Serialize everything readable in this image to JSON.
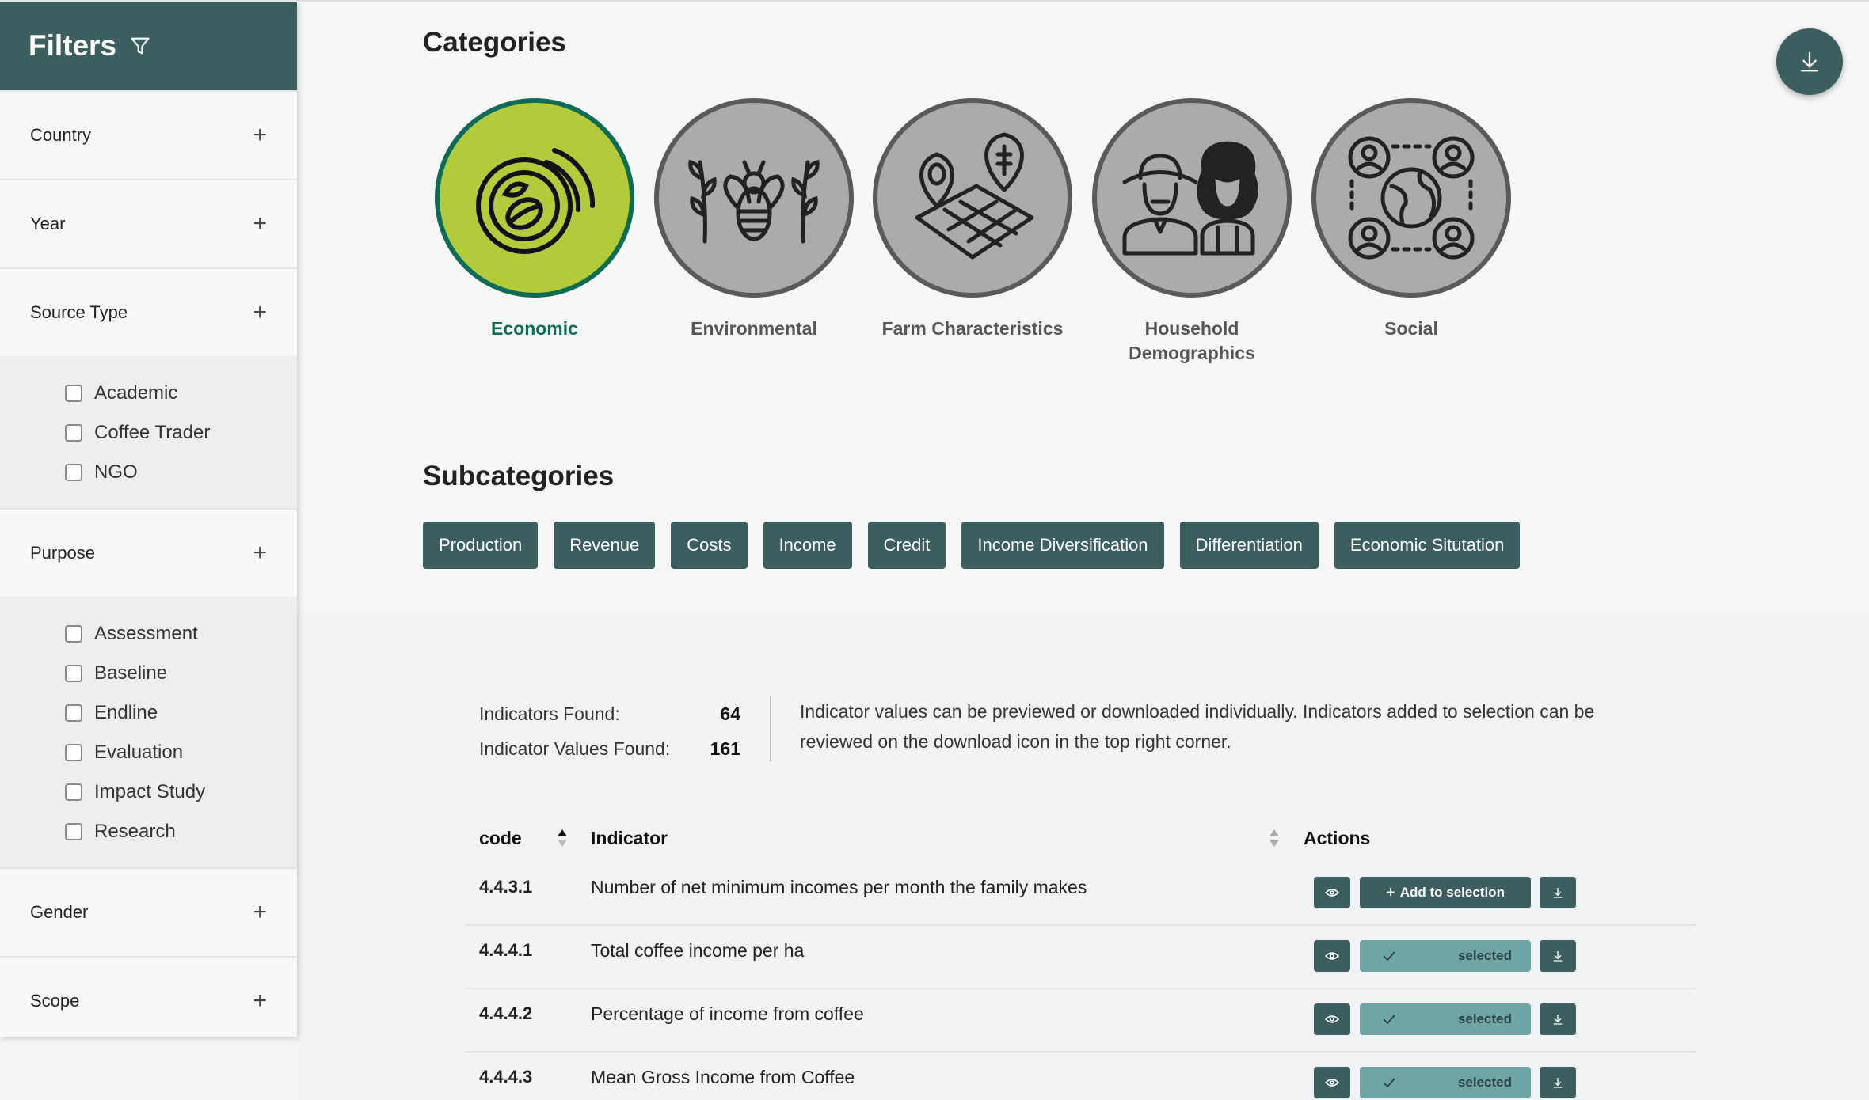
{
  "sidebar": {
    "title": "Filters",
    "sections": [
      {
        "label": "Country",
        "options": []
      },
      {
        "label": "Year",
        "options": []
      },
      {
        "label": "Source Type",
        "options": [
          "Academic",
          "Coffee Trader",
          "NGO"
        ]
      },
      {
        "label": "Purpose",
        "options": [
          "Assessment",
          "Baseline",
          "Endline",
          "Evaluation",
          "Impact Study",
          "Research"
        ]
      },
      {
        "label": "Gender",
        "options": []
      },
      {
        "label": "Scope",
        "options": []
      }
    ]
  },
  "categories": {
    "title": "Categories",
    "items": [
      {
        "label": "Economic",
        "icon": "coffee-beans-icon",
        "active": true
      },
      {
        "label": "Environmental",
        "icon": "bee-plants-icon",
        "active": false
      },
      {
        "label": "Farm Characteristics",
        "icon": "farm-map-icon",
        "active": false
      },
      {
        "label": "Household Demographics",
        "icon": "farmers-icon",
        "active": false
      },
      {
        "label": "Social",
        "icon": "community-globe-icon",
        "active": false
      }
    ]
  },
  "subcategories": {
    "title": "Subcategories",
    "items": [
      "Production",
      "Revenue",
      "Costs",
      "Income",
      "Credit",
      "Income Diversification",
      "Differentiation",
      "Economic Situtation"
    ]
  },
  "stats": {
    "indicators_label": "Indicators Found:",
    "indicators_value": "64",
    "values_label": "Indicator Values Found:",
    "values_value": "161",
    "info": "Indicator values can be previewed or downloaded individually. Indicators added to selection can be reviewed on the download icon in the top right corner."
  },
  "table": {
    "headers": {
      "code": "code",
      "indicator": "Indicator",
      "actions": "Actions"
    },
    "rows": [
      {
        "code": "4.4.3.1",
        "indicator": "Number of net minimum incomes per month the family makes",
        "selected": false
      },
      {
        "code": "4.4.4.1",
        "indicator": "Total coffee income per ha",
        "selected": true
      },
      {
        "code": "4.4.4.2",
        "indicator": "Percentage of income from coffee",
        "selected": true
      },
      {
        "code": "4.4.4.3",
        "indicator": "Mean Gross Income from Coffee",
        "selected": true
      }
    ],
    "add_label": "Add to selection",
    "selected_label": "selected"
  },
  "colors": {
    "primary": "#3d5e5f",
    "accent": "#b2cb3a",
    "active_text": "#0f6b58",
    "selected": "#6ea6a6"
  }
}
